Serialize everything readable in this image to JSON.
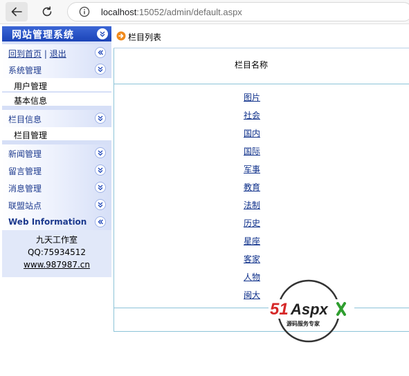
{
  "browser": {
    "url_host": "localhost",
    "url_rest": ":15052/admin/default.aspx"
  },
  "nav": {
    "title": "网站管理系统",
    "home_link": "回到首页",
    "separator": "|",
    "logout_link": "退出",
    "sections": [
      {
        "label": "系统管理",
        "items": [
          "用户管理",
          "基本信息"
        ]
      },
      {
        "label": "栏目信息",
        "items": [
          "栏目管理"
        ]
      },
      {
        "label": "新闻管理",
        "items": []
      },
      {
        "label": "留言管理",
        "items": []
      },
      {
        "label": "消息管理",
        "items": []
      },
      {
        "label": "联盟站点",
        "items": []
      },
      {
        "label": "Web Information",
        "items": []
      }
    ],
    "info": {
      "studio": "九天工作室",
      "qq": "QQ:75934512",
      "site": "www.987987.cn"
    }
  },
  "main": {
    "title": "栏目列表",
    "column_header": "栏目名称",
    "categories": [
      "图片",
      "社会",
      "国内",
      "国际",
      "军事",
      "教育",
      "法制",
      "历史",
      "星座",
      "客家",
      "人物",
      "闽大"
    ]
  },
  "watermark": {
    "brand": "51Aspx",
    "tagline": "源码服务专家"
  },
  "colors": {
    "nav_header": "#1b44b8",
    "nav_bg": "#d6dff7",
    "link": "#1d3a8e",
    "frame_border": "#8cc3d8",
    "watermark_red": "#d62828",
    "watermark_green": "#2f9e2f"
  }
}
